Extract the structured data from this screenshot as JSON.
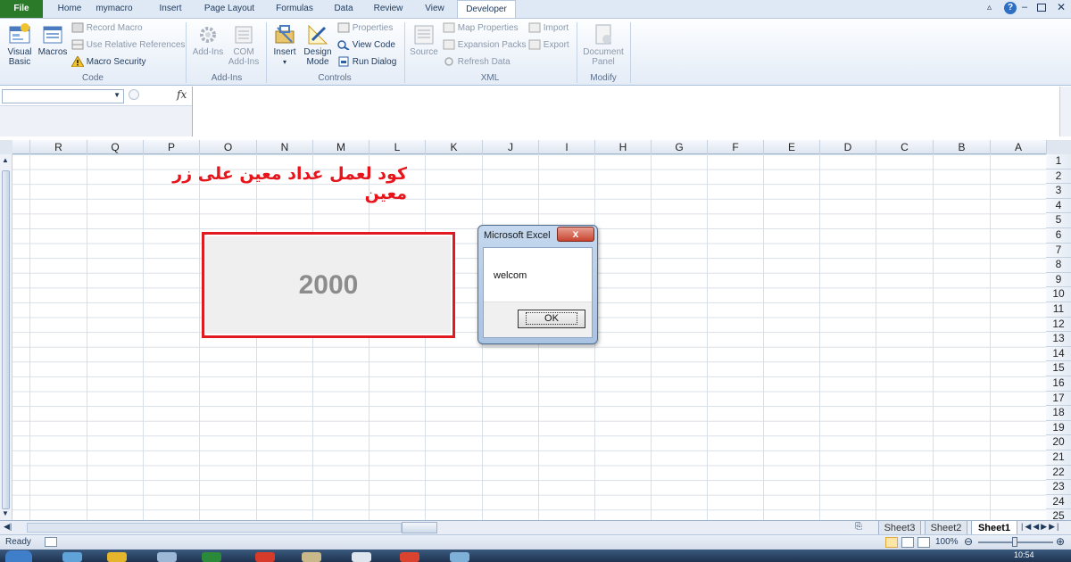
{
  "tabs": {
    "file": "File",
    "items": [
      "Home",
      "mymacro",
      "Insert",
      "Page Layout",
      "Formulas",
      "Data",
      "Review",
      "View",
      "Developer"
    ]
  },
  "ribbon": {
    "code": {
      "label": "Code",
      "visual_basic_1": "Visual",
      "visual_basic_2": "Basic",
      "macros": "Macros",
      "record_macro": "Record Macro",
      "relative_refs": "Use Relative References",
      "macro_security": "Macro Security"
    },
    "addins": {
      "label": "Add-Ins",
      "addins": "Add-Ins",
      "com_1": "COM",
      "com_2": "Add-Ins"
    },
    "controls": {
      "label": "Controls",
      "insert": "Insert",
      "design_1": "Design",
      "design_2": "Mode",
      "properties": "Properties",
      "view_code": "View Code",
      "run_dialog": "Run Dialog"
    },
    "xml": {
      "label": "XML",
      "source": "Source",
      "map_properties": "Map Properties",
      "expansion_packs": "Expansion Packs",
      "refresh_data": "Refresh Data",
      "import": "Import",
      "export": "Export"
    },
    "modify": {
      "label": "Modify",
      "doc_1": "Document",
      "doc_2": "Panel"
    }
  },
  "formula_bar": {
    "fx": "fx",
    "namebox_value": "",
    "formula_value": ""
  },
  "columns": [
    "R",
    "Q",
    "P",
    "O",
    "N",
    "M",
    "L",
    "K",
    "J",
    "I",
    "H",
    "G",
    "F",
    "E",
    "D",
    "C",
    "B",
    "A"
  ],
  "rows": [
    "1",
    "2",
    "3",
    "4",
    "5",
    "6",
    "7",
    "8",
    "9",
    "10",
    "11",
    "12",
    "13",
    "14",
    "15",
    "16",
    "17",
    "18",
    "19",
    "20",
    "21",
    "22",
    "23",
    "24",
    "25"
  ],
  "sheet": {
    "title_text": "كود لعمل عداد معين على زر معين",
    "counter_value": "2000"
  },
  "dialog": {
    "title": "Microsoft Excel",
    "close": "x",
    "message": "welcom",
    "ok": "OK"
  },
  "sheet_tabs": [
    "Sheet3",
    "Sheet2",
    "Sheet1"
  ],
  "status": {
    "ready": "Ready",
    "zoom": "100%"
  },
  "taskbar": {
    "clock": "10:54"
  },
  "colors": {
    "accent_red": "#e11a22",
    "file_tab": "#2a7a2a"
  }
}
